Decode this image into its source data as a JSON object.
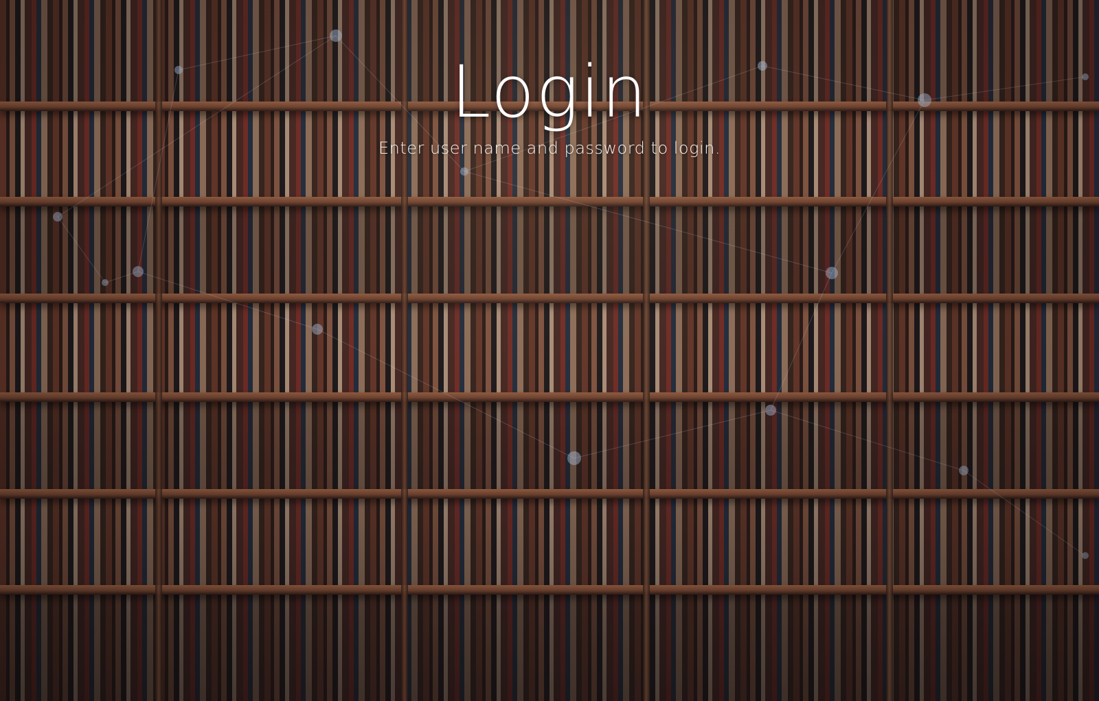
{
  "login": {
    "title": "Login",
    "subtitle": "Enter user name and password to login."
  },
  "background": {
    "image_subject": "bookshelves",
    "overlay_color": "#1b1416",
    "accent_color": "#ffffff"
  }
}
